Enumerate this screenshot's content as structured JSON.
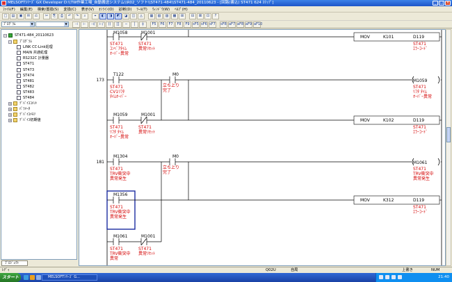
{
  "window": {
    "title": "MELSOFTｼﾘｰｽﾞ GX Developer D:\\\\TW作業工場_自動搬送システム\\\\R02_ソフト\\\\ST471-484\\\\ST471-484_20110623 - [回路(書込)    ST471    624 ｽﾃｯﾌﾟ]"
  },
  "menu": [
    "ﾌｧｲﾙ(F)",
    "編集(E)",
    "検索/置換(S)",
    "変換(C)",
    "表示(V)",
    "ｵﾝﾗｲﾝ(O)",
    "診断(D)",
    "ﾂｰﾙ(T)",
    "ｳｨﾝﾄﾞｳ(W)",
    "ﾍﾙﾌﾟ(H)"
  ],
  "toolbar": {
    "row1": [
      "□",
      "▤",
      "▣",
      "✉",
      "⎌",
      "✂",
      "⎘",
      "⎙",
      "↶",
      "↷",
      "⌕",
      "⌖",
      "◧",
      "◨",
      "◩",
      "◪",
      "◫",
      "◬",
      "▦",
      "▧",
      "▨",
      "▩",
      "⊞",
      "⊟",
      "⊠",
      "⊡",
      "?"
    ],
    "program_combo": "ﾌﾟﾛｸﾞﾗﾑ",
    "row2": [
      "⊣",
      "⊢",
      "⊣/",
      "⊢/",
      "()",
      "[]",
      "─",
      "│",
      "┼",
      "F5",
      "F6",
      "F7",
      "F8",
      "F9",
      "sF5",
      "sF6",
      "sF7",
      "sF8",
      "aF7",
      "aF8",
      "aF9",
      "aF10"
    ]
  },
  "tree": {
    "project": "ST471-484_20110623",
    "items": [
      {
        "label": "ﾌﾟﾛｸﾞﾗﾑ",
        "level": 1,
        "icon": "folder"
      },
      {
        "label": "LINK CC-Link処理",
        "level": 2,
        "icon": "doc"
      },
      {
        "label": "MAIN 共通処理",
        "level": 2,
        "icon": "doc"
      },
      {
        "label": "RS232C 計量器",
        "level": 2,
        "icon": "doc"
      },
      {
        "label": "ST471",
        "level": 2,
        "icon": "doc"
      },
      {
        "label": "ST473",
        "level": 2,
        "icon": "doc"
      },
      {
        "label": "ST474",
        "level": 2,
        "icon": "doc"
      },
      {
        "label": "ST481",
        "level": 2,
        "icon": "doc"
      },
      {
        "label": "ST482",
        "level": 2,
        "icon": "doc"
      },
      {
        "label": "ST483",
        "level": 2,
        "icon": "doc"
      },
      {
        "label": "ST484",
        "level": 2,
        "icon": "doc"
      },
      {
        "label": "ﾃﾞﾊﾞｲｽｺﾒﾝﾄ",
        "level": 1,
        "icon": "folder"
      },
      {
        "label": "ﾊﾟﾗﾒｰﾀ",
        "level": 1,
        "icon": "folder"
      },
      {
        "label": "ﾃﾞﾊﾞｲｽﾒﾓﾘ",
        "level": 1,
        "icon": "folder"
      },
      {
        "label": "ﾃﾞﾊﾞｲｽ初期値",
        "level": 1,
        "icon": "folder"
      }
    ],
    "tab": "ﾌﾟﾛｼﾞｪｸﾄ"
  },
  "ladder": {
    "steps": [
      "173",
      "181"
    ],
    "devices": {
      "m1058": "M1058",
      "m1001": "M1001",
      "t122": "T122",
      "m0": "M0",
      "m1059": "M1059",
      "m1304": "M1304",
      "m1356": "M1356",
      "m1061": "M1061",
      "d119": "D119"
    },
    "instructions": {
      "mov": "MOV",
      "k101": "K101",
      "k102": "K102",
      "k312": "K312"
    },
    "comments": {
      "st471": "ST471",
      "conveyor_over": "ｺﾝﾍﾞｱﾀｲﾑ",
      "over_abnormal": "ｵｰﾊﾞｰ異常",
      "abnormal_reset": "異常ﾘｾｯﾄ",
      "error_code": "ｴﾗｰｺｰﾄﾞ",
      "cv1_lifter": "CV1ﾘﾌﾀ",
      "time_over": "ﾀｲﾑｵｰﾊﾞｰ",
      "rise": "立ち上り",
      "done": "完了",
      "lifter_time": "ﾘﾌﾀ  ﾀｲﾑ",
      "trv_collision": "TRV衝突中",
      "abnormal_occur": "異常発生",
      "abnormal": "異常"
    }
  },
  "status": {
    "cpu": "Q02U",
    "station": "自局",
    "mode": "上書き",
    "num": "NUM",
    "hint": "ﾚﾃﾞｨ"
  },
  "taskbar": {
    "start": "スタート",
    "item": "MELSOFTｼﾘｰｽﾞ G...",
    "time": "21:40"
  }
}
